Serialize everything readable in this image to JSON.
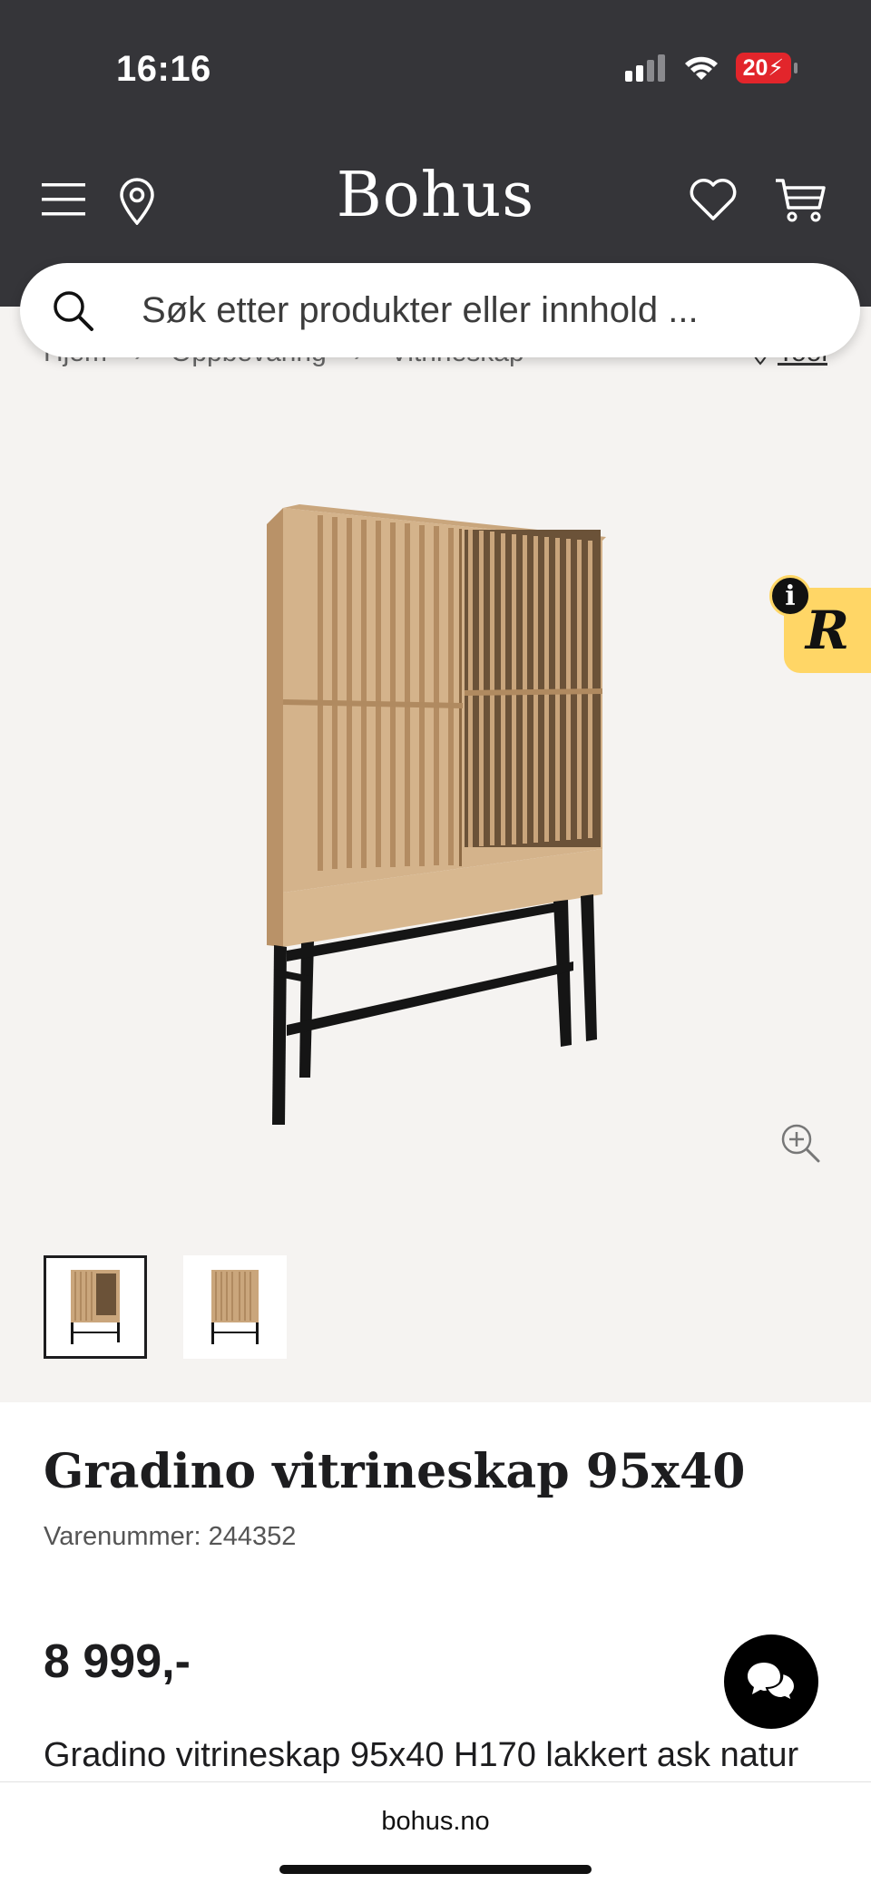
{
  "status_bar": {
    "time": "16:16",
    "battery": "20"
  },
  "header": {
    "logo": "Bohus",
    "menu_icon": "hamburger-menu-icon",
    "location_icon": "location-pin-icon",
    "wishlist_icon": "heart-icon",
    "cart_icon": "cart-icon"
  },
  "search": {
    "placeholder": "Søk etter produkter eller innhold ..."
  },
  "breadcrumb": {
    "items": [
      "Hjem",
      "Oppbevaring",
      "Vitrineskap"
    ],
    "right_label": "Tool"
  },
  "gallery": {
    "thumbnails": [
      "thumbnail-1",
      "thumbnail-2"
    ],
    "active_index": 0
  },
  "product": {
    "title": "Gradino vitrineskap 95x40",
    "sku": "Varenummer: 244352",
    "price": "8 999,-",
    "description": "Gradino vitrineskap 95x40 H170 lakkert ask natur"
  },
  "browser": {
    "url": "bohus.no"
  },
  "colors": {
    "header_bg": "#353539",
    "badge_yellow": "#ffd666",
    "battery_red": "#e2252b"
  }
}
